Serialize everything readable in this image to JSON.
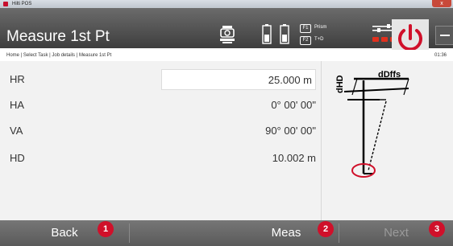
{
  "window": {
    "title": "Hilti POS",
    "close_glyph": "x"
  },
  "header": {
    "title": "Measure 1st Pt",
    "status": {
      "f1_key": "F1",
      "f1_label": "Prism",
      "f2_key": "F2",
      "f2_label": "T+D",
      "battery_left": "100",
      "battery_right": "100"
    },
    "minimize_glyph": "—"
  },
  "breadcrumb": {
    "path": "Home | Select Task | Job details | Measure 1st Pt",
    "time": "01:36"
  },
  "measurements": [
    {
      "label": "HR",
      "value": "25.000 m",
      "editable": true
    },
    {
      "label": "HA",
      "value": "0° 00' 00\"",
      "editable": false
    },
    {
      "label": "VA",
      "value": "90° 00' 00\"",
      "editable": false
    },
    {
      "label": "HD",
      "value": "10.002 m",
      "editable": false
    }
  ],
  "diagram": {
    "label_dhd": "dHD",
    "label_dffs": "dDffs",
    "highlight_color": "#d0102a"
  },
  "footer": {
    "back_label": "Back",
    "meas_label": "Meas",
    "next_label": "Next",
    "badges": [
      "1",
      "2",
      "3"
    ],
    "accent": "#d0102a"
  }
}
